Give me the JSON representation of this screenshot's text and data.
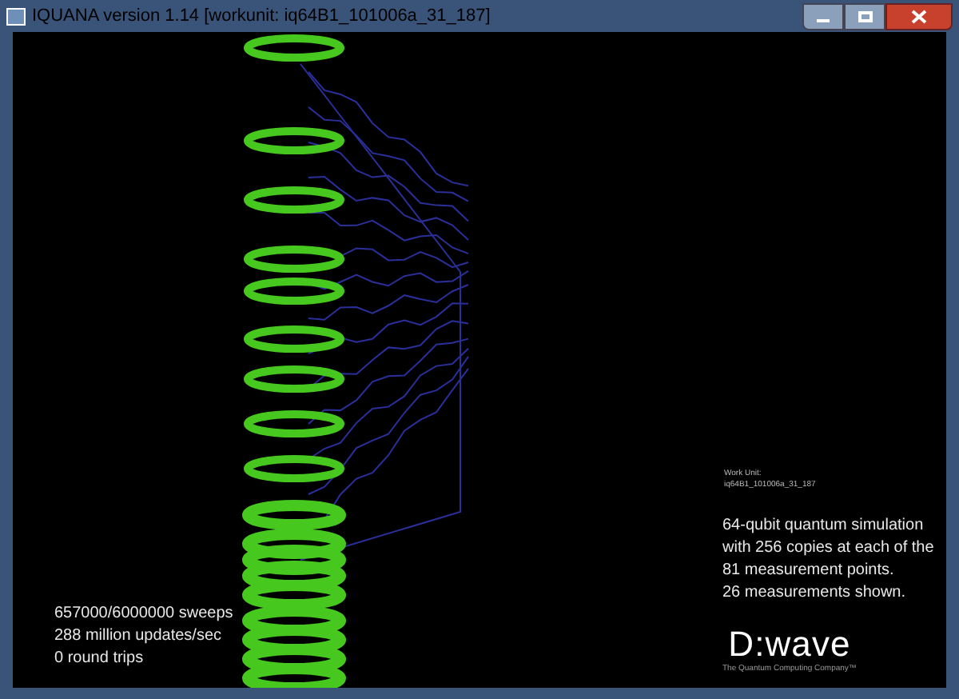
{
  "window": {
    "title": "IQUANA version 1.14 [workunit: iq64B1_101006a_31_187]"
  },
  "stats": [
    "657000/6000000 sweeps",
    "288 million updates/sec",
    "0 round trips"
  ],
  "workunit": {
    "label": "Work Unit:",
    "name": "iq64B1_101006a_31_187"
  },
  "description": [
    "64-qubit quantum simulation",
    "with 256 copies at each of the",
    "81 measurement points.",
    "26 measurements shown."
  ],
  "logo": {
    "name": "D:wave",
    "tagline": "The Quantum Computing Company™"
  }
}
